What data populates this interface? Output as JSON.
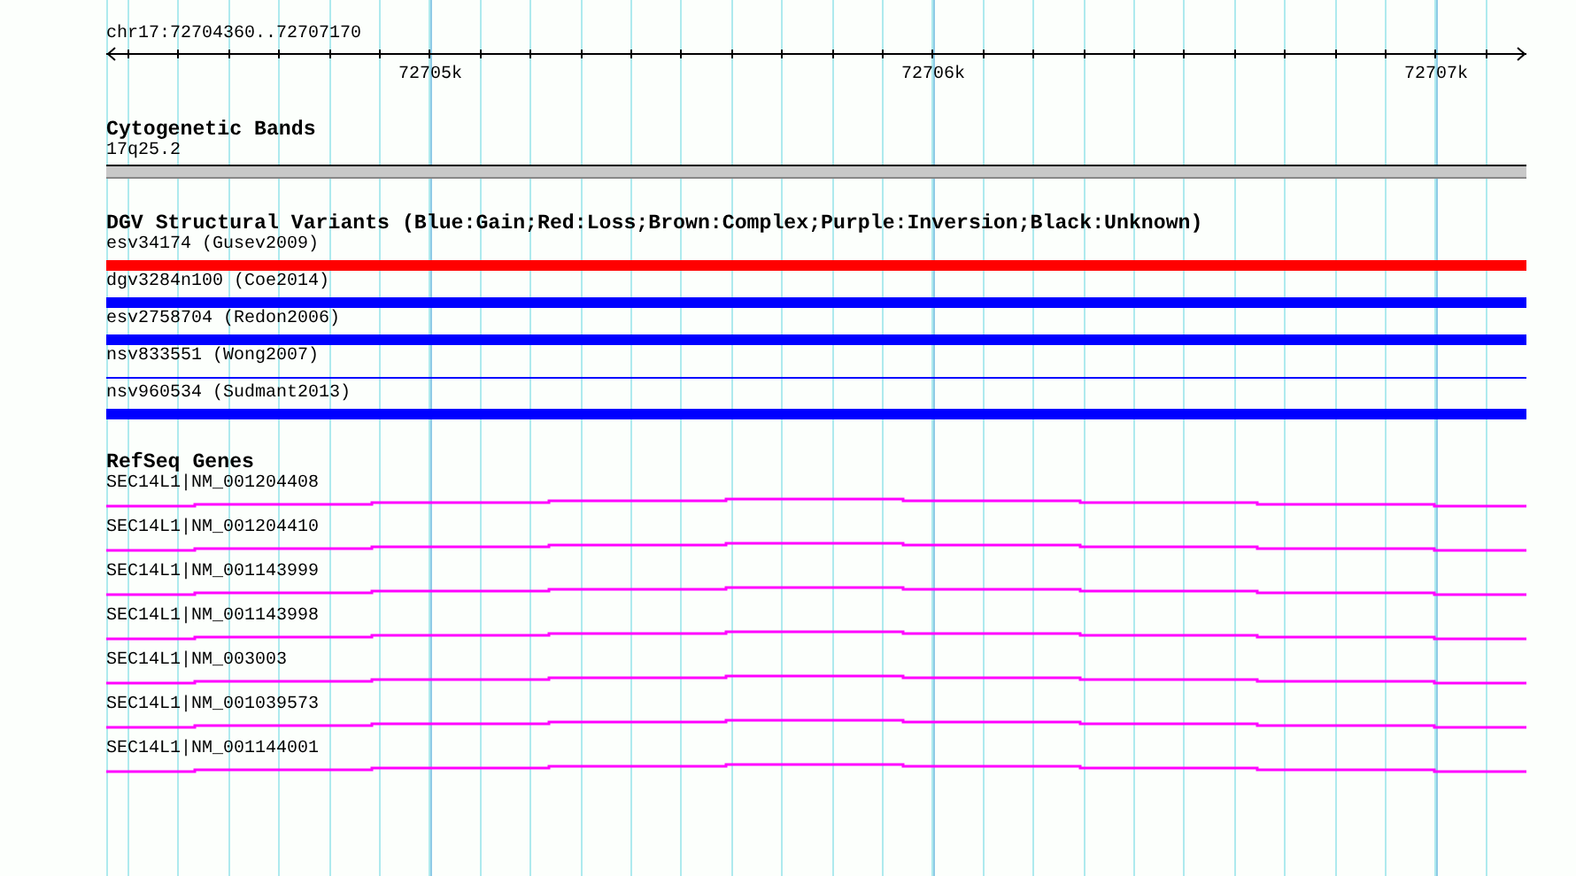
{
  "ruler": {
    "range": "chr17:72704360..72707170",
    "ticks": [
      "72705k",
      "72706k",
      "72707k"
    ]
  },
  "cytogenetic_bands": {
    "title": "Cytogenetic Bands",
    "band": "17q25.2"
  },
  "dgv_variants": {
    "title": "DGV Structural Variants (Blue:Gain;Red:Loss;Brown:Complex;Purple:Inversion;Black:Unknown)",
    "items": [
      {
        "label": "esv34174 (Gusev2009)",
        "color": "#ff0000",
        "kind": "thick"
      },
      {
        "label": "dgv3284n100 (Coe2014)",
        "color": "#0000ff",
        "kind": "thick"
      },
      {
        "label": "esv2758704 (Redon2006)",
        "color": "#0000ff",
        "kind": "thick"
      },
      {
        "label": "nsv833551 (Wong2007)",
        "color": "#0000ff",
        "kind": "thin"
      },
      {
        "label": "nsv960534 (Sudmant2013)",
        "color": "#0000ff",
        "kind": "thick"
      }
    ]
  },
  "refseq_genes": {
    "title": "RefSeq Genes",
    "items": [
      {
        "label": "SEC14L1|NM_001204408"
      },
      {
        "label": "SEC14L1|NM_001204410"
      },
      {
        "label": "SEC14L1|NM_001143999"
      },
      {
        "label": "SEC14L1|NM_001143998"
      },
      {
        "label": "SEC14L1|NM_003003"
      },
      {
        "label": "SEC14L1|NM_001039573"
      },
      {
        "label": "SEC14L1|NM_001144001"
      }
    ]
  }
}
